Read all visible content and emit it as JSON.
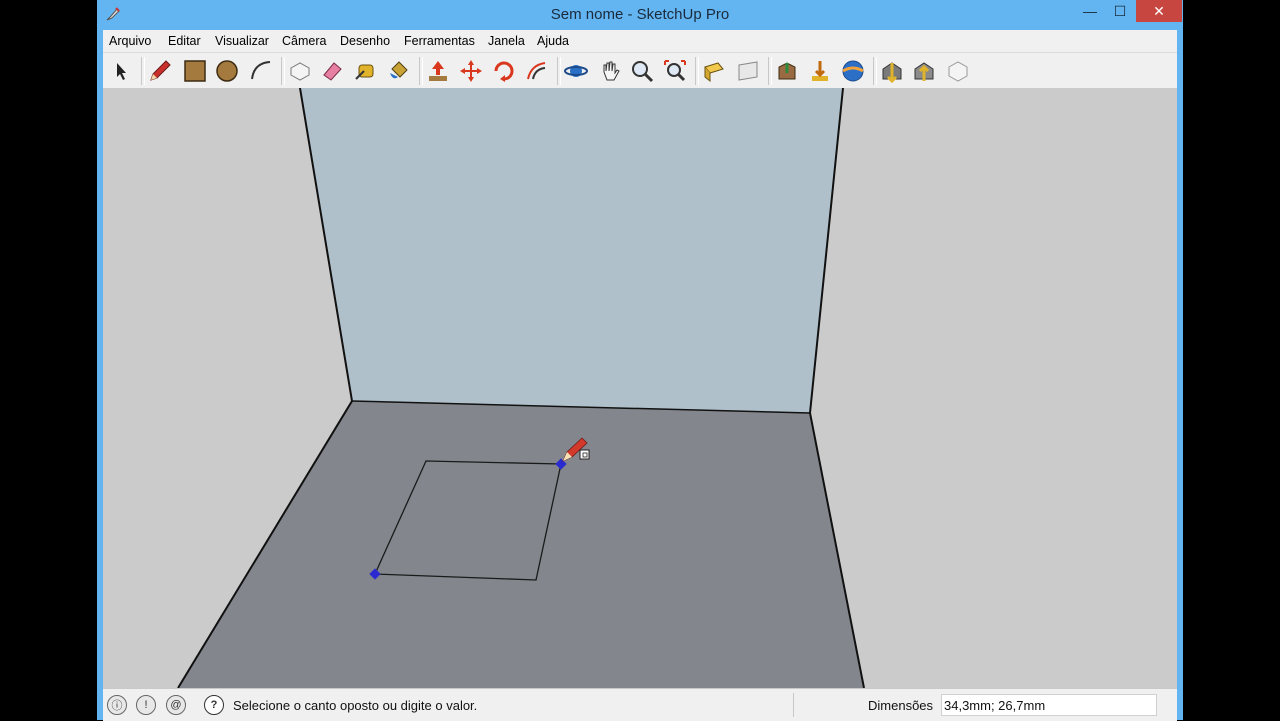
{
  "window": {
    "title": "Sem nome - SketchUp Pro",
    "close_glyph": "✕",
    "min_glyph": "—",
    "max_glyph": "☐"
  },
  "menu": [
    "Arquivo",
    "Editar",
    "Visualizar",
    "Câmera",
    "Desenho",
    "Ferramentas",
    "Janela",
    "Ajuda"
  ],
  "toolbar": {
    "tools": [
      "select",
      "line",
      "rectangle",
      "circle",
      "arc",
      "make-component",
      "eraser",
      "tape-measure",
      "paint-bucket",
      "push-pull",
      "move",
      "rotate",
      "offset",
      "orbit",
      "pan",
      "zoom",
      "zoom-extents",
      "previous-view",
      "next-view",
      "get-models",
      "share-model",
      "share-component",
      "get-photo-texture",
      "warehouse",
      "extension-warehouse",
      "layout"
    ]
  },
  "status": {
    "message": "Selecione o canto oposto ou digite o valor.",
    "vcb_label": "Dimensões",
    "vcb_value": "34,3mm; 26,7mm"
  },
  "colors": {
    "titlebar": "#63b5f2",
    "sky_wall": "#afc0cb",
    "floor": "#83878d",
    "side_wall": "#cbcbcb",
    "close_button": "#c7463f",
    "vertex": "#2a2ad0"
  }
}
